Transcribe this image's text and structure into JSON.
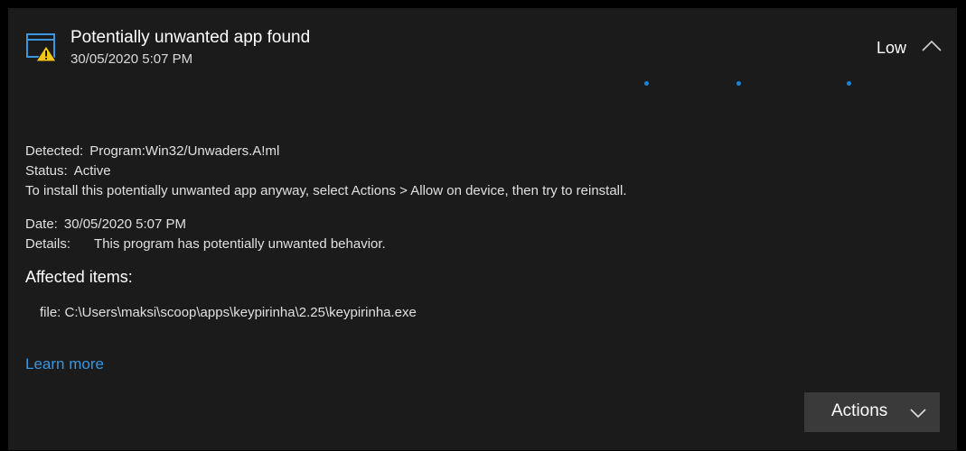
{
  "header": {
    "icon": "window-warning-icon",
    "title": "Potentially unwanted app found",
    "timestamp": "30/05/2020 5:07 PM",
    "severity": "Low",
    "collapse_icon": "chevron-up-icon"
  },
  "loading_indicator": {
    "color": "#1a86d9"
  },
  "details": {
    "detected_label": "Detected:",
    "detected_value": "Program:Win32/Unwaders.A!ml",
    "status_label": "Status:",
    "status_value": "Active",
    "instruction": "To install this potentially unwanted app anyway, select Actions > Allow on device, then try to reinstall.",
    "date_label": "Date:",
    "date_value": "30/05/2020 5:07 PM",
    "details_label": "Details:",
    "details_value": "This program has potentially unwanted behavior."
  },
  "affected": {
    "title": "Affected items:",
    "file": "file: C:\\Users\\maksi\\scoop\\apps\\keypirinha\\2.25\\keypirinha.exe"
  },
  "learn_more": "Learn more",
  "actions": {
    "label": "Actions",
    "icon": "chevron-down-icon"
  },
  "colors": {
    "background": "#1b1b1c",
    "accent": "#3a96dd",
    "warning": "#f5c518"
  }
}
